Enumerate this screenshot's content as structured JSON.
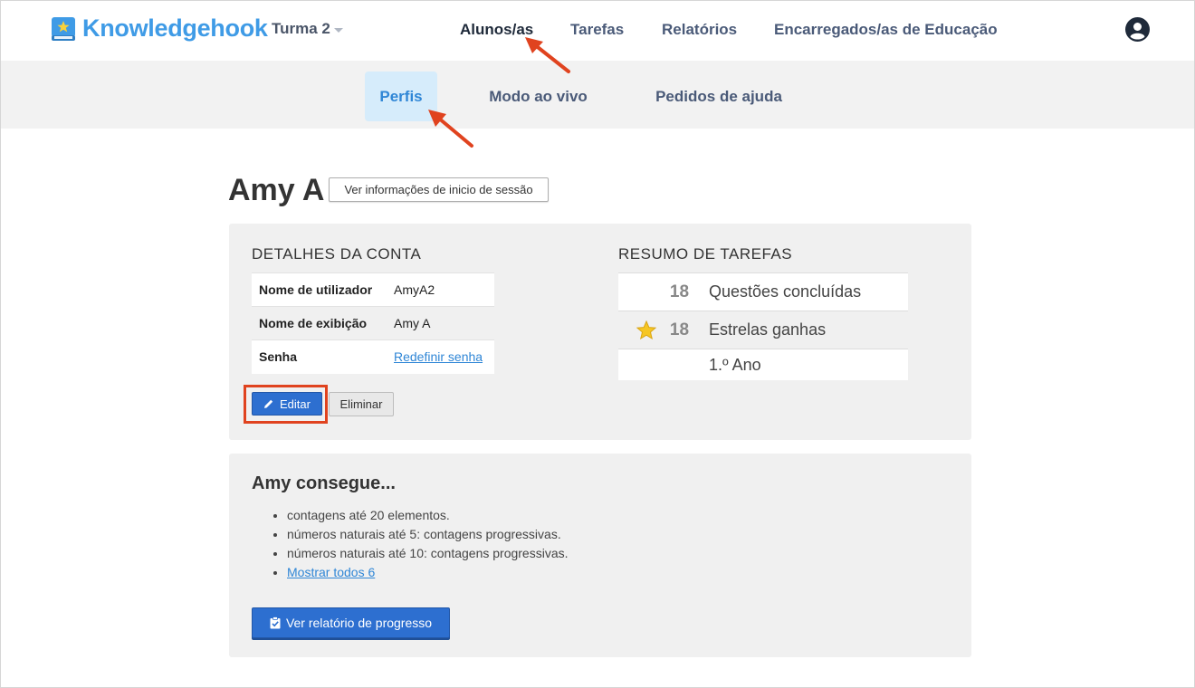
{
  "brand": {
    "name": "Knowledgehook"
  },
  "class_selector": {
    "value": "Turma 2"
  },
  "top_nav": [
    {
      "label": "Alunos/as",
      "active": true
    },
    {
      "label": "Tarefas"
    },
    {
      "label": "Relatórios"
    },
    {
      "label": "Encarregados/as de Educação"
    }
  ],
  "sub_nav": [
    {
      "label": "Perfis",
      "active": true
    },
    {
      "label": "Modo ao vivo"
    },
    {
      "label": "Pedidos de ajuda"
    }
  ],
  "student": {
    "name": "Amy A",
    "login_info_button": "Ver informações de inicio de sessão"
  },
  "account": {
    "title": "DETALHES DA CONTA",
    "rows": [
      {
        "key": "Nome de utilizador",
        "value": "AmyA2"
      },
      {
        "key": "Nome de exibição",
        "value": "Amy A"
      },
      {
        "key": "Senha",
        "value": "Redefinir senha"
      }
    ],
    "edit_button": "Editar",
    "delete_button": "Eliminar"
  },
  "summary": {
    "title": "RESUMO DE TAREFAS",
    "rows": [
      {
        "number": "18",
        "label": "Questões concluídas"
      },
      {
        "number": "18",
        "label": "Estrelas ganhas"
      },
      {
        "number": "",
        "label": "1.º Ano"
      }
    ]
  },
  "can_do": {
    "title": "Amy consegue...",
    "items": [
      "contagens até 20 elementos.",
      "números naturais até 5: contagens progressivas.",
      "números naturais até 10: contagens progressivas."
    ],
    "show_all": "Mostrar todos 6",
    "report_button": "Ver relatório de progresso"
  },
  "colors": {
    "brand_blue": "#3f9be6",
    "button_blue": "#2d6fd0",
    "annotation_red": "#e0431f",
    "active_subtab_bg": "#d6ecfb"
  }
}
